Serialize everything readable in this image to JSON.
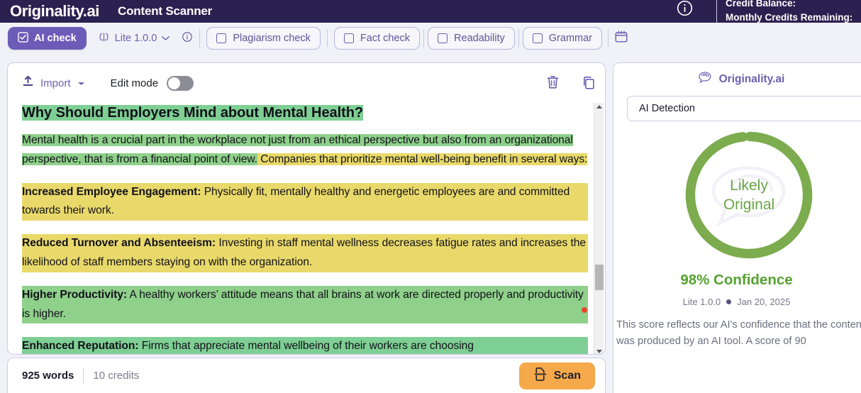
{
  "topbar": {
    "brand": "Originality.ai",
    "app_title": "Content Scanner",
    "info_icon": "info-circle-icon",
    "credit_tooltip": {
      "line1": "Credit Balance:",
      "line2": "Monthly Credits Remaining:"
    }
  },
  "checkbar": {
    "ai_check": {
      "label": "AI check",
      "icon": "checkbox-checked-icon",
      "active": true
    },
    "model": {
      "label": "Lite 1.0.0",
      "icon": "brain-icon",
      "chevron": "chevron-down-icon",
      "info": "info-circle-icon"
    },
    "checks": [
      {
        "label": "Plagiarism check",
        "checked": false
      },
      {
        "label": "Fact check",
        "checked": false
      },
      {
        "label": "Readability",
        "checked": false
      },
      {
        "label": "Grammar",
        "checked": false
      }
    ],
    "calendar_icon": "calendar-icon"
  },
  "editor": {
    "import": {
      "label": "Import",
      "icon": "upload-icon",
      "chevron": "chevron-down-icon"
    },
    "edit_mode": {
      "label": "Edit mode",
      "enabled": false
    },
    "delete_icon": "trash-icon",
    "copy_icon": "copy-icon",
    "document": {
      "heading": "Why Should Employers Mind about Mental Health?",
      "paragraphs": [
        {
          "segments": [
            {
              "text": "Mental health is a crucial part in the workplace not just from an ethical perspective but also from an organizational perspective, that is from a financial point of view.",
              "highlight": "green"
            },
            {
              "text": " Companies that prioritize mental well-being benefit in several ways:",
              "highlight": "yellow"
            }
          ]
        },
        {
          "bold": "Increased Employee Engagement:",
          "text": " Physically fit, mentally healthy and energetic employees are and committed towards their work.",
          "highlight": "yellow"
        },
        {
          "bold": "Reduced Turnover and Absenteeism:",
          "text": " Investing in staff mental wellness decreases fatigue rates and increases the likelihood of staff members staying on with the organization.",
          "highlight": "yellow"
        },
        {
          "bold": "Higher Productivity:",
          "text": " A healthy workers’ attitude means that all brains at work are directed properly and productivity is higher.",
          "highlight": "green"
        },
        {
          "bold": "Enhanced Reputation:",
          "text": " Firms that appreciate mental wellbeing of their workers are choosing",
          "highlight": "green2"
        }
      ]
    }
  },
  "footer": {
    "word_count": "925 words",
    "credits": "10 credits",
    "scan": {
      "label": "Scan",
      "icon": "scan-icon"
    }
  },
  "panel": {
    "header": {
      "label": "Originality.ai",
      "icon": "originality-swirl-icon"
    },
    "select_value": "AI Detection",
    "gauge": {
      "label_line1": "Likely",
      "label_line2": "Original",
      "percent": 98,
      "ring_color": "#7cac4e",
      "track_color": "#ffffff"
    },
    "confidence": "98% Confidence",
    "meta": {
      "model": "Lite 1.0.0",
      "date": "Jan 20, 2025"
    },
    "description": "This score reflects our AI's confidence that the content scanned was produced by an AI tool. A score of 90"
  },
  "colors": {
    "navy": "#2b2150",
    "purple": "#6b5fb0",
    "accent_purple": "#6c5cb8",
    "orange": "#f5a94a",
    "green": "#55a230",
    "highlight_green": "#8fd08b",
    "highlight_yellow": "#e9d96a",
    "page_bg": "#f1f2f8"
  }
}
